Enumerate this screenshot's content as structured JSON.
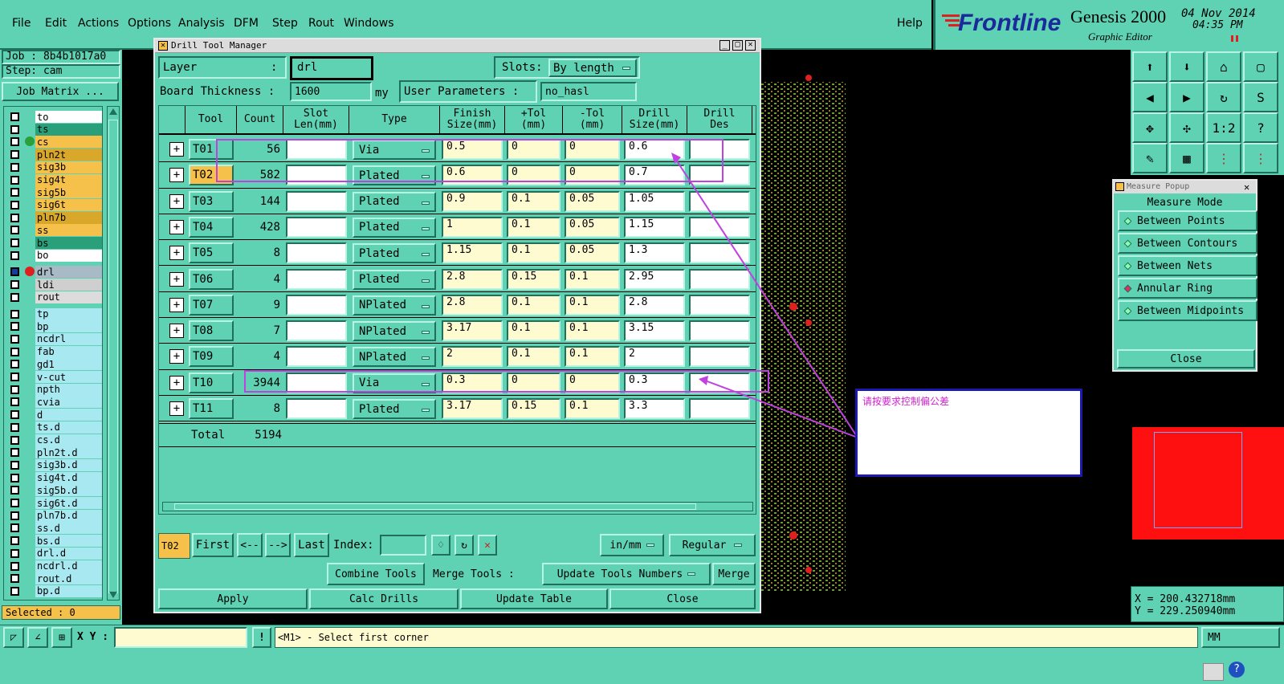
{
  "menubar": {
    "items": [
      "File",
      "Edit",
      "Actions",
      "Options",
      "Analysis",
      "DFM",
      "Step",
      "Rout",
      "Windows"
    ],
    "help": "Help"
  },
  "logo": {
    "brand": "Frontline",
    "product": "Genesis 2000",
    "subtitle": "Graphic Editor",
    "date": "04 Nov 2014",
    "time": "04:35 PM"
  },
  "job": {
    "job_label": "Job : 8b4b1017a0",
    "step_label": "Step: cam",
    "job_matrix": "Job Matrix ...",
    "selected": "Selected : 0"
  },
  "layers": [
    {
      "name": "to",
      "color": "#ffffff"
    },
    {
      "name": "ts",
      "color": "#2aa07a"
    },
    {
      "name": "cs",
      "color": "#f5c14b"
    },
    {
      "name": "pln2t",
      "color": "#d9a72a"
    },
    {
      "name": "sig3b",
      "color": "#f5c14b"
    },
    {
      "name": "sig4t",
      "color": "#f5c14b"
    },
    {
      "name": "sig5b",
      "color": "#f5c14b"
    },
    {
      "name": "sig6t",
      "color": "#f5c14b"
    },
    {
      "name": "pln7b",
      "color": "#d9a72a"
    },
    {
      "name": "ss",
      "color": "#f5c14b"
    },
    {
      "name": "bs",
      "color": "#2aa07a"
    },
    {
      "name": "bo",
      "color": "#ffffff"
    },
    {
      "name": "drl",
      "color": "#a7bac5"
    },
    {
      "name": "ldi",
      "color": "#cfcfcf"
    },
    {
      "name": "rout",
      "color": "#dcdcdc"
    },
    {
      "name": "tp",
      "color": "#a8e8f0"
    },
    {
      "name": "bp",
      "color": "#a8e8f0"
    },
    {
      "name": "ncdrl",
      "color": "#a8e8f0"
    },
    {
      "name": "fab",
      "color": "#a8e8f0"
    },
    {
      "name": "gd1",
      "color": "#a8e8f0"
    },
    {
      "name": "v-cut",
      "color": "#a8e8f0"
    },
    {
      "name": "npth",
      "color": "#a8e8f0"
    },
    {
      "name": "cvia",
      "color": "#a8e8f0"
    },
    {
      "name": "d",
      "color": "#a8e8f0"
    },
    {
      "name": "ts.d",
      "color": "#a8e8f0"
    },
    {
      "name": "cs.d",
      "color": "#a8e8f0"
    },
    {
      "name": "pln2t.d",
      "color": "#a8e8f0"
    },
    {
      "name": "sig3b.d",
      "color": "#a8e8f0"
    },
    {
      "name": "sig4t.d",
      "color": "#a8e8f0"
    },
    {
      "name": "sig5b.d",
      "color": "#a8e8f0"
    },
    {
      "name": "sig6t.d",
      "color": "#a8e8f0"
    },
    {
      "name": "pln7b.d",
      "color": "#a8e8f0"
    },
    {
      "name": "ss.d",
      "color": "#a8e8f0"
    },
    {
      "name": "bs.d",
      "color": "#a8e8f0"
    },
    {
      "name": "drl.d",
      "color": "#a8e8f0"
    },
    {
      "name": "ncdrl.d",
      "color": "#a8e8f0"
    },
    {
      "name": "rout.d",
      "color": "#a8e8f0"
    },
    {
      "name": "bp.d",
      "color": "#a8e8f0"
    }
  ],
  "dtm": {
    "title": "Drill Tool Manager",
    "layer_label": "Layer",
    "layer_sep": ":",
    "layer_value": "drl",
    "slots_label": "Slots:",
    "slots_value": "By length",
    "board_thickness_label": "Board Thickness :",
    "board_thickness_value": "1600",
    "board_thickness_unit": "my",
    "user_params_label": "User Parameters :",
    "user_params_value": "no_hasl",
    "headers": [
      "Tool",
      "Count",
      "Slot\nLen(mm)",
      "Type",
      "Finish\nSize(mm)",
      "+Tol\n(mm)",
      "-Tol\n(mm)",
      "Drill\nSize(mm)",
      "Drill\nDes"
    ],
    "rows": [
      {
        "tool": "T01",
        "count": "56",
        "type": "Via",
        "finish": "0.5",
        "ptol": "0",
        "mtol": "0",
        "drill": "0.6"
      },
      {
        "tool": "T02",
        "count": "582",
        "type": "Plated",
        "finish": "0.6",
        "ptol": "0",
        "mtol": "0",
        "drill": "0.7"
      },
      {
        "tool": "T03",
        "count": "144",
        "type": "Plated",
        "finish": "0.9",
        "ptol": "0.1",
        "mtol": "0.05",
        "drill": "1.05"
      },
      {
        "tool": "T04",
        "count": "428",
        "type": "Plated",
        "finish": "1",
        "ptol": "0.1",
        "mtol": "0.05",
        "drill": "1.15"
      },
      {
        "tool": "T05",
        "count": "8",
        "type": "Plated",
        "finish": "1.15",
        "ptol": "0.1",
        "mtol": "0.05",
        "drill": "1.3"
      },
      {
        "tool": "T06",
        "count": "4",
        "type": "Plated",
        "finish": "2.8",
        "ptol": "0.15",
        "mtol": "0.1",
        "drill": "2.95"
      },
      {
        "tool": "T07",
        "count": "9",
        "type": "NPlated",
        "finish": "2.8",
        "ptol": "0.1",
        "mtol": "0.1",
        "drill": "2.8"
      },
      {
        "tool": "T08",
        "count": "7",
        "type": "NPlated",
        "finish": "3.17",
        "ptol": "0.1",
        "mtol": "0.1",
        "drill": "3.15"
      },
      {
        "tool": "T09",
        "count": "4",
        "type": "NPlated",
        "finish": "2",
        "ptol": "0.1",
        "mtol": "0.1",
        "drill": "2"
      },
      {
        "tool": "T10",
        "count": "3944",
        "type": "Via",
        "finish": "0.3",
        "ptol": "0",
        "mtol": "0",
        "drill": "0.3"
      },
      {
        "tool": "T11",
        "count": "8",
        "type": "Plated",
        "finish": "3.17",
        "ptol": "0.15",
        "mtol": "0.1",
        "drill": "3.3"
      }
    ],
    "total_label": "Total",
    "total_count": "5194",
    "current_tool": "T02",
    "nav": {
      "first": "First",
      "prev": "<--",
      "next": "-->",
      "last": "Last",
      "index_label": "Index:"
    },
    "units": "in/mm",
    "mode": "Regular",
    "combine": "Combine Tools",
    "merge_label": "Merge Tools :",
    "merge_value": "Update Tools Numbers",
    "merge_btn": "Merge",
    "apply": "Apply",
    "calc": "Calc Drills",
    "update": "Update Table",
    "close": "Close"
  },
  "measure": {
    "title": "Measure Popup",
    "mode_label": "Measure Mode",
    "options": [
      "Between Points",
      "Between Contours",
      "Between Nets",
      "Annular Ring",
      "Between Midpoints"
    ],
    "selected": "Annular Ring",
    "close": "Close"
  },
  "annotation": {
    "text": "请按要求控制偏公差"
  },
  "coords": {
    "x": "X = 200.432718mm",
    "y": "Y = 229.250940mm"
  },
  "status": {
    "xy_label": "X Y :",
    "message": "<M1> - Select first corner",
    "units": "MM"
  }
}
